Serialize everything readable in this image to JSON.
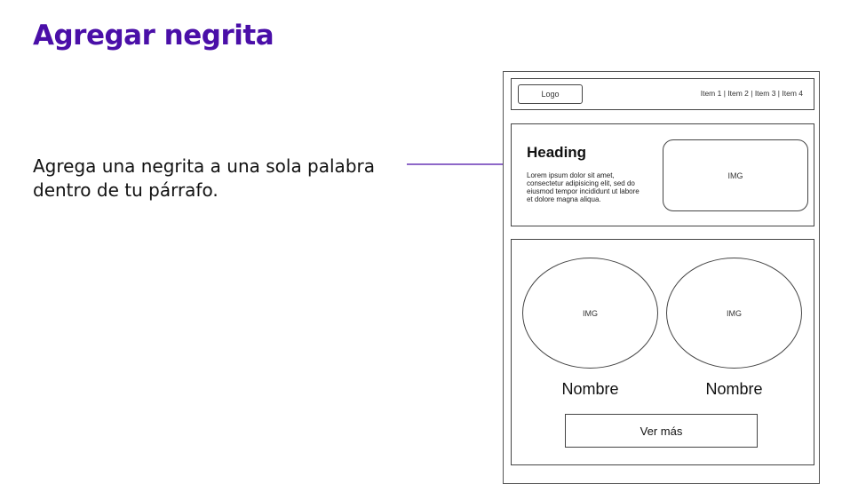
{
  "slide": {
    "title": "Agregar negrita",
    "instruction": "Agrega una negrita a una sola palabra dentro de tu párrafo.",
    "accent_color": "#4a0fa8"
  },
  "wireframe": {
    "nav": {
      "logo": "Logo",
      "items": "Item 1 | Item 2 | Item 3 | Item 4"
    },
    "hero": {
      "heading": "Heading",
      "text": "Lorem ipsum dolor sit amet, consectetur adipisicing elit, sed do eiusmod tempor incididunt ut labore et dolore magna aliqua.",
      "img_label": "IMG"
    },
    "team": {
      "members": [
        {
          "img_label": "IMG",
          "name": "Nombre"
        },
        {
          "img_label": "IMG",
          "name": "Nombre"
        }
      ],
      "button": "Ver más"
    }
  }
}
